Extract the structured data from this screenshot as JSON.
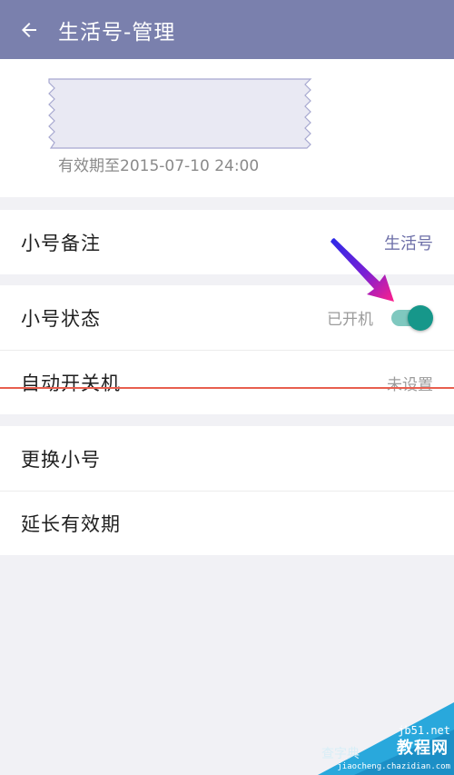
{
  "app_bar": {
    "title": "生活号-管理"
  },
  "number_card": {
    "validity": "有效期至2015-07-10 24:00"
  },
  "settings": {
    "remark": {
      "label": "小号备注",
      "value": "生活号"
    },
    "status": {
      "label": "小号状态",
      "value": "已开机",
      "toggle_on": true
    },
    "auto_power": {
      "label": "自动开关机",
      "value": "未设置"
    },
    "change_number": {
      "label": "更换小号"
    },
    "extend_validity": {
      "label": "延长有效期"
    }
  },
  "colors": {
    "app_bar": "#7a80ad",
    "accent_value": "#6d6fa8",
    "toggle_thumb": "#16978a",
    "toggle_track": "#7fc8bf",
    "annotation_line": "#e85f4f"
  },
  "watermark": {
    "line1": "jb51.net",
    "line2": "教程网",
    "line3": "jiaocheng.chazidian.com",
    "line4": "查字典"
  }
}
